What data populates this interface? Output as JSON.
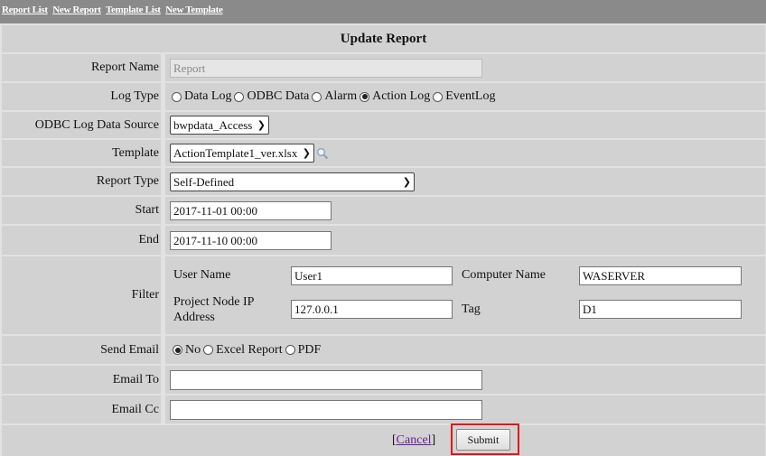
{
  "nav": {
    "report_list": "Report List",
    "new_report": "New Report",
    "template_list": "Template List",
    "new_template": "New Template"
  },
  "form": {
    "title": "Update Report",
    "report_name": {
      "label": "Report Name",
      "value": "Report"
    },
    "log_type": {
      "label": "Log Type",
      "options": [
        "Data Log",
        "ODBC Data",
        "Alarm",
        "Action Log",
        "EventLog"
      ],
      "selected": "Action Log"
    },
    "odbc_source": {
      "label": "ODBC Log Data Source",
      "value": "bwpdata_Access"
    },
    "template": {
      "label": "Template",
      "value": "ActionTemplate1_ver.xlsx"
    },
    "report_type": {
      "label": "Report Type",
      "value": "Self-Defined"
    },
    "start": {
      "label": "Start",
      "value": "2017-11-01 00:00"
    },
    "end": {
      "label": "End",
      "value": "2017-11-10 00:00"
    },
    "filter": {
      "label": "Filter",
      "user_name_label": "User Name",
      "user_name_value": "User1",
      "computer_name_label": "Computer Name",
      "computer_name_value": "WASERVER",
      "ip_label_line1": "Project Node IP",
      "ip_label_line2": "Address",
      "ip_value": "127.0.0.1",
      "tag_label": "Tag",
      "tag_value": "D1"
    },
    "send_email": {
      "label": "Send Email",
      "options": [
        "No",
        "Excel Report",
        "PDF"
      ],
      "selected": "No"
    },
    "email_to": {
      "label": "Email To",
      "value": ""
    },
    "email_cc": {
      "label": "Email Cc",
      "value": ""
    },
    "cancel_label": "Cancel",
    "submit_label": "Submit"
  },
  "colors": {
    "topbar": "#8a8a8a",
    "cell": "#d2d2d2",
    "highlight": "#e0181a",
    "link_visited": "#6a1b9a"
  }
}
